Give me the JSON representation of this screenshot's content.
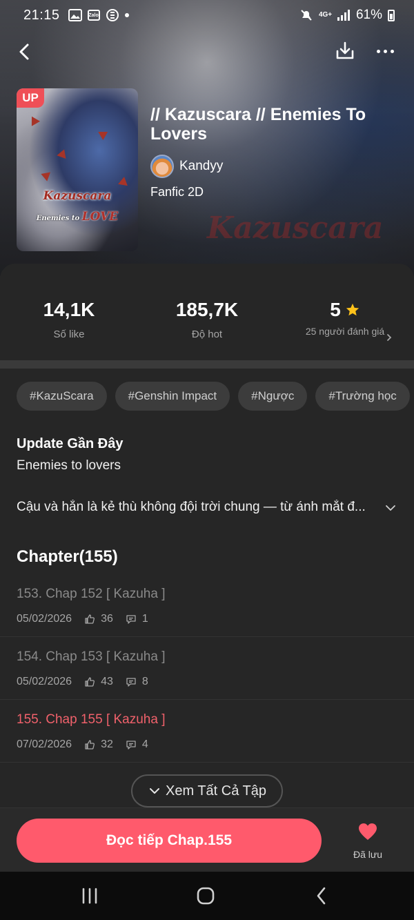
{
  "status_bar": {
    "time": "21:15",
    "zalo_label": "Zalo",
    "network": "4G+",
    "battery": "61%"
  },
  "book": {
    "badge": "UP",
    "title": "// Kazuscara // Enemies To Lovers",
    "author": "Kandyy",
    "genre": "Fanfic 2D",
    "cover_title": "Kazuscara",
    "cover_subtitle": "Enemies to",
    "cover_love": "LOVE"
  },
  "stats": {
    "likes_value": "14,1K",
    "likes_label": "Số like",
    "hot_value": "185,7K",
    "hot_label": "Độ hot",
    "rating_value": "5",
    "rating_label": "25 người đánh giá"
  },
  "tags": [
    "#KazuScara",
    "#Genshin Impact",
    "#Ngược",
    "#Trường học"
  ],
  "update": {
    "title": "Update Gần Đây",
    "text": "Enemies to lovers"
  },
  "synopsis": "Cậu và hắn là kẻ thù không đội trời chung — từ ánh mắt đ...",
  "chapters_heading": "Chapter(155)",
  "chapters": [
    {
      "title": "153. Chap 152 [ Kazuha ]",
      "date": "05/02/2026",
      "likes": "36",
      "comments": "1"
    },
    {
      "title": "154. Chap 153 [ Kazuha ]",
      "date": "05/02/2026",
      "likes": "43",
      "comments": "8"
    },
    {
      "title": "155. Chap 155 [ Kazuha ]",
      "date": "07/02/2026",
      "likes": "32",
      "comments": "4"
    }
  ],
  "view_all_label": "Xem Tất Cả Tập",
  "bottom": {
    "read_label": "Đọc tiếp Chap.155",
    "saved_label": "Đã lưu"
  },
  "colors": {
    "accent": "#ff5a6c",
    "current_chapter": "#f0616b",
    "star": "#ffc21a"
  }
}
